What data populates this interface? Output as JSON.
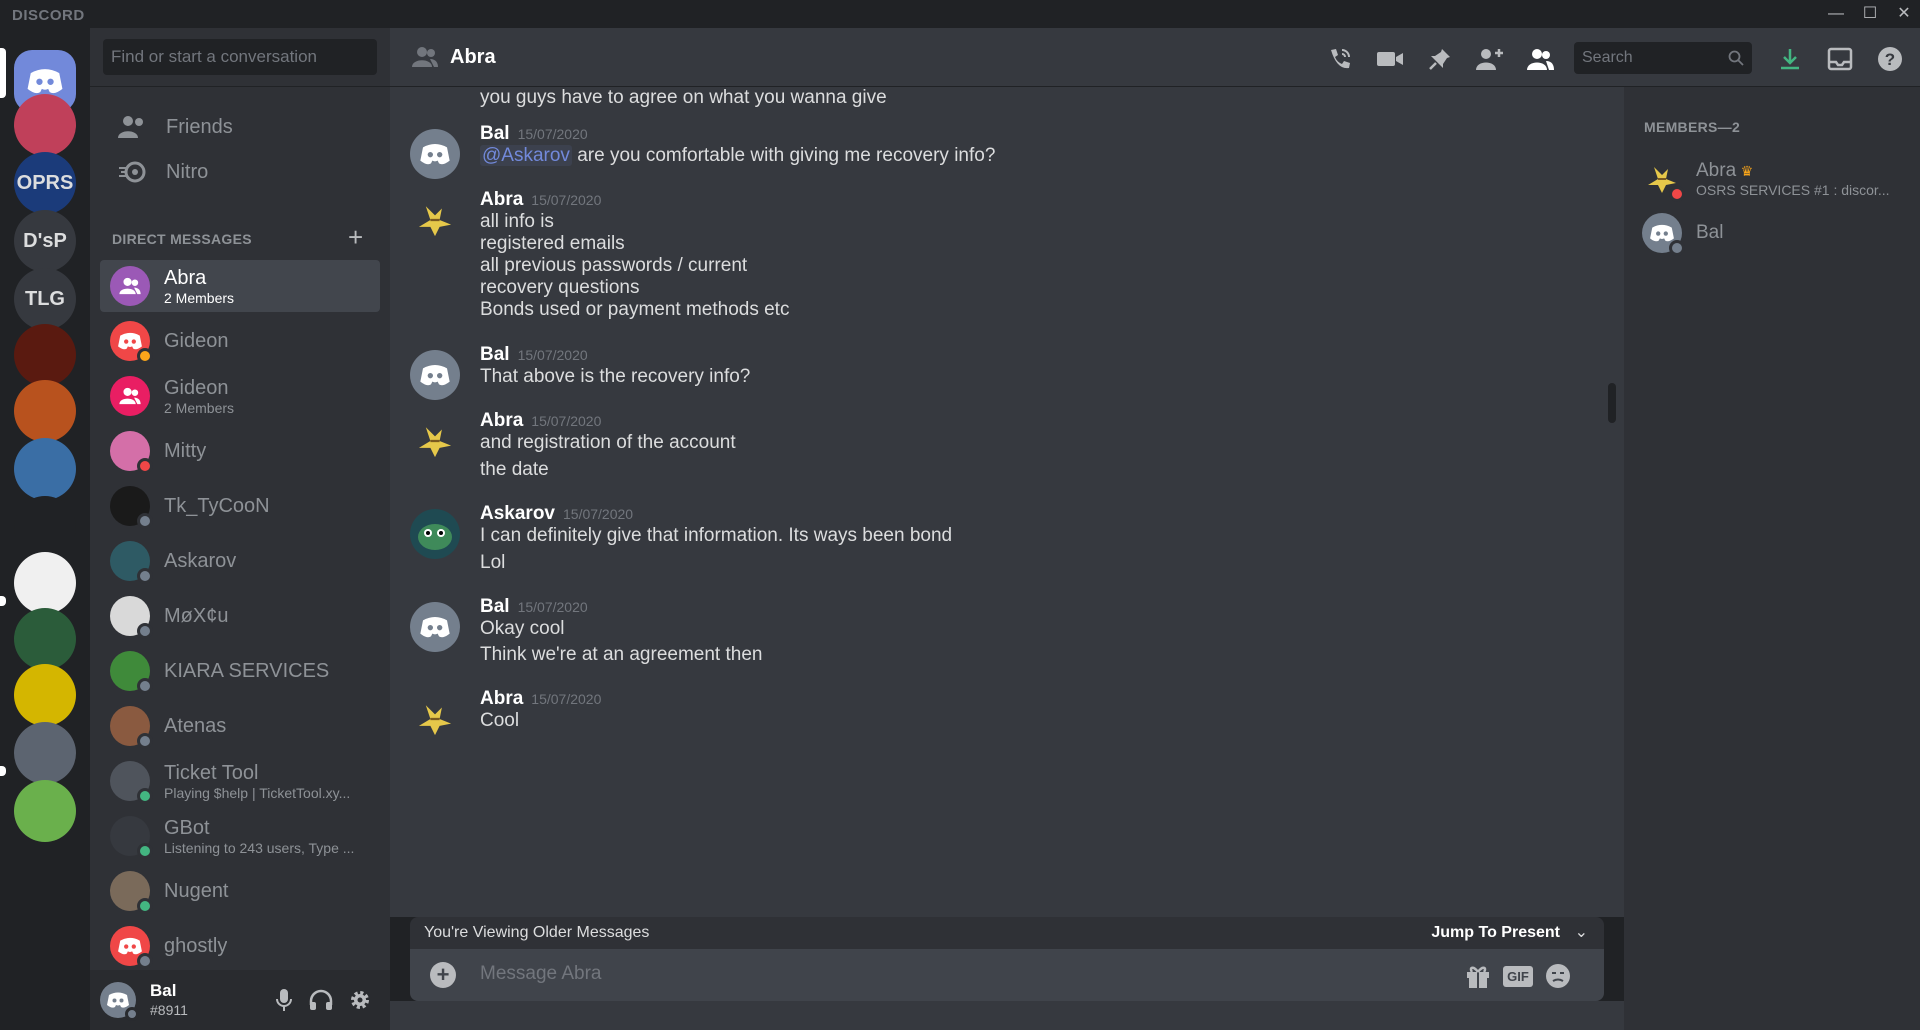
{
  "window": {
    "brand": "DISCORD",
    "minimize": "—",
    "maximize": "☐",
    "close": "✕"
  },
  "servers": [
    {
      "kind": "home"
    },
    {
      "kind": "image",
      "color": "#c0405a"
    },
    {
      "kind": "text",
      "label": "OPRS",
      "color": "#1b3b7a"
    },
    {
      "kind": "text",
      "label": "D'sP",
      "color": "#36393f"
    },
    {
      "kind": "text",
      "label": "TLG",
      "color": "#36393f"
    },
    {
      "kind": "image",
      "color": "#5a1a10"
    },
    {
      "kind": "image",
      "color": "#b8521e"
    },
    {
      "kind": "image",
      "color": "#3a6ea5"
    },
    {
      "kind": "image",
      "color": "#202225"
    },
    {
      "kind": "image",
      "color": "#f0f0f0"
    },
    {
      "kind": "image",
      "color": "#2b5c3a"
    },
    {
      "kind": "image",
      "color": "#d4b600"
    },
    {
      "kind": "image",
      "color": "#5c6470"
    },
    {
      "kind": "image",
      "color": "#6ab04c"
    }
  ],
  "dm_sidebar": {
    "search_placeholder": "Find or start a conversation",
    "nav": [
      {
        "label": "Friends",
        "icon": "friends-icon"
      },
      {
        "label": "Nitro",
        "icon": "nitro-icon"
      }
    ],
    "header": "DIRECT MESSAGES",
    "add_label": "+",
    "items": [
      {
        "name": "Abra",
        "sub": "2 Members",
        "avatar_color": "#9b59b6",
        "group": true,
        "status": "",
        "active": true
      },
      {
        "name": "Gideon",
        "sub": "",
        "avatar_color": "#f04747",
        "group": false,
        "status": "#faa61a"
      },
      {
        "name": "Gideon",
        "sub": "2 Members",
        "avatar_color": "#e91e63",
        "group": true,
        "status": ""
      },
      {
        "name": "Mitty",
        "sub": "",
        "avatar_color": "#d46fa8",
        "group": false,
        "status": "#f04747"
      },
      {
        "name": "Tk_TyCooN",
        "sub": "",
        "avatar_color": "#1a1a1a",
        "group": false,
        "status": "#747f8d"
      },
      {
        "name": "Askarov",
        "sub": "",
        "avatar_color": "#2e5a64",
        "group": false,
        "status": "#747f8d"
      },
      {
        "name": "MøX¢u",
        "sub": "",
        "avatar_color": "#d9d9d9",
        "group": false,
        "status": "#747f8d"
      },
      {
        "name": "KIARA SERVICES",
        "sub": "",
        "avatar_color": "#3f8a3a",
        "group": false,
        "status": "#747f8d"
      },
      {
        "name": "Atenas",
        "sub": "",
        "avatar_color": "#8a5a40",
        "group": false,
        "status": "#747f8d"
      },
      {
        "name": "Ticket Tool",
        "sub": "Playing $help | TicketTool.xy...",
        "avatar_color": "#4f545c",
        "group": false,
        "status": "#43b581"
      },
      {
        "name": "GBot",
        "sub": "Listening to 243 users, Type ...",
        "avatar_color": "#36393f",
        "group": false,
        "status": "#43b581"
      },
      {
        "name": "Nugent",
        "sub": "",
        "avatar_color": "#7a6a5a",
        "group": false,
        "status": "#43b581"
      },
      {
        "name": "ghostly",
        "sub": "",
        "avatar_color": "#f04747",
        "group": false,
        "status": "#747f8d"
      }
    ]
  },
  "user_panel": {
    "username": "Bal",
    "tag": "#8911"
  },
  "chat_header": {
    "title": "Abra",
    "search_placeholder": "Search"
  },
  "messages": {
    "continuation": "you guys have to agree on what you wanna give",
    "groups": [
      {
        "author": "Bal",
        "timestamp": "15/07/2020",
        "avatar": "discord",
        "lines": [
          {
            "mention": "@Askarov",
            "text": " are you comfortable with giving me recovery info?"
          }
        ]
      },
      {
        "author": "Abra",
        "timestamp": "15/07/2020",
        "avatar": "abra",
        "lines": [
          {
            "text": "all info is"
          },
          {
            "text": "registered emails"
          },
          {
            "text": "all previous passwords / current"
          },
          {
            "text": "recovery questions"
          },
          {
            "text": "Bonds used or payment methods etc"
          }
        ]
      },
      {
        "author": "Bal",
        "timestamp": "15/07/2020",
        "avatar": "discord",
        "lines": [
          {
            "text": "That above is the recovery info?"
          }
        ]
      },
      {
        "author": "Abra",
        "timestamp": "15/07/2020",
        "avatar": "abra",
        "lines": [
          {
            "text": "and registration of the account"
          },
          {
            "text": "the date"
          }
        ]
      },
      {
        "author": "Askarov",
        "timestamp": "15/07/2020",
        "avatar": "askarov",
        "lines": [
          {
            "text": "I can definitely give that information. Its ways been bond"
          },
          {
            "text": "Lol"
          }
        ]
      },
      {
        "author": "Bal",
        "timestamp": "15/07/2020",
        "avatar": "discord",
        "lines": [
          {
            "text": "Okay cool"
          },
          {
            "text": "Think we're at an agreement then"
          }
        ]
      },
      {
        "author": "Abra",
        "timestamp": "15/07/2020",
        "avatar": "abra",
        "lines": [
          {
            "text": "Cool"
          }
        ]
      }
    ]
  },
  "older_bar": {
    "left": "You're Viewing Older Messages",
    "right": "Jump To Present"
  },
  "composer": {
    "placeholder": "Message Abra",
    "gif_label": "GIF"
  },
  "members": {
    "header": "MEMBERS—2",
    "list": [
      {
        "name": "Abra",
        "owner": true,
        "activity": "OSRS SERVICES #1 : discor...",
        "avatar": "abra",
        "status": "#f04747"
      },
      {
        "name": "Bal",
        "owner": false,
        "activity": "",
        "avatar": "discord",
        "status": "#747f8d"
      }
    ]
  },
  "colors": {
    "blurple": "#7289da",
    "online": "#43b581",
    "idle": "#faa61a",
    "dnd": "#f04747",
    "offline": "#747f8d",
    "download": "#43b581"
  }
}
